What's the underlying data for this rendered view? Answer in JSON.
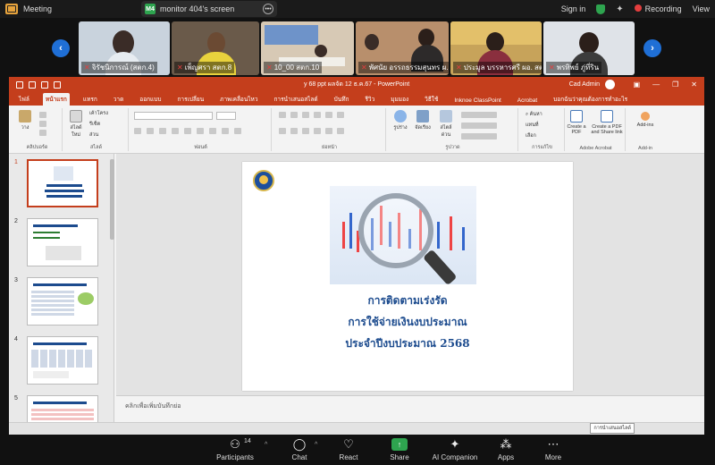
{
  "topbar": {
    "app_title": "Meeting",
    "screen_badge": "M4",
    "screen_label": "monitor 404's screen",
    "signin": "Sign in",
    "recording": "Recording",
    "view": "View"
  },
  "participants": [
    {
      "name": "จิรัชนิการณ์ (สตก.4)"
    },
    {
      "name": "เพ็ญศรา สตก.8"
    },
    {
      "name": "10_00 สตก.10"
    },
    {
      "name": "พัศนัย อรรถธรรมสุนทร ผ..."
    },
    {
      "name": "ประมูล บรรหารศรี ผอ. สต..."
    },
    {
      "name": "พรทิพย์ ภู่ที่ริน"
    }
  ],
  "ppt": {
    "doc_title": "y 68 ppt ผลจัด 12 ธ.ค.67 - PowerPoint",
    "account": "Cad Admin",
    "tabs": [
      "ไฟล์",
      "หน้าแรก",
      "แทรก",
      "วาด",
      "ออกแบบ",
      "การเปลี่ยน",
      "ภาพเคลื่อนไหว",
      "การนำเสนอสไลด์",
      "บันทึก",
      "รีวิว",
      "มุมมอง",
      "วิธีใช้",
      "Inknoe ClassPoint",
      "Acrobat",
      "บอกฉันว่าคุณต้องการทำอะไร"
    ],
    "ribbon": {
      "paste": "วาง",
      "new_slide": "สไลด์ใหม่",
      "layout": "เค้าโครง",
      "reset": "รีเซ็ต",
      "section": "ส่วน",
      "shapes": "รูปร่าง",
      "arrange": "จัดเรียง",
      "quick_styles": "สไตล์ด่วน",
      "find": "ค้นหา",
      "replace": "แทนที่",
      "select": "เลือก",
      "create_pdf": "Create a PDF",
      "create_pdf_share": "Create a PDF and Share link",
      "addins": "Add-ins",
      "group_clipboard": "คลิปบอร์ด",
      "group_slides": "สไลด์",
      "group_font": "ฟอนต์",
      "group_paragraph": "ย่อหน้า",
      "group_drawing": "รูปวาด",
      "group_editing": "การแก้ไข",
      "group_acrobat": "Adobe Acrobat",
      "group_addins": "Add-in"
    },
    "thumb_numbers": [
      "1",
      "2",
      "3",
      "4",
      "5"
    ],
    "slide": {
      "line1": "การติดตามเร่งรัด",
      "line2": "การใช้จ่ายเงินงบประมาณ",
      "line3": "ประจำปีงบประมาณ 2568"
    },
    "notes_placeholder": "คลิกเพื่อเพิ่มบันทึกย่อ",
    "status_tooltip": "การนำเสนอสไลด์"
  },
  "controls": {
    "participants": "Participants",
    "participants_count": "14",
    "chat": "Chat",
    "react": "React",
    "share": "Share",
    "ai": "AI Companion",
    "apps": "Apps",
    "more": "More"
  },
  "colors": {
    "ppt_accent": "#c43e1c",
    "share_green": "#2ea44f",
    "nav_blue": "#1f6fd6",
    "slide_text": "#1c4b8e"
  }
}
